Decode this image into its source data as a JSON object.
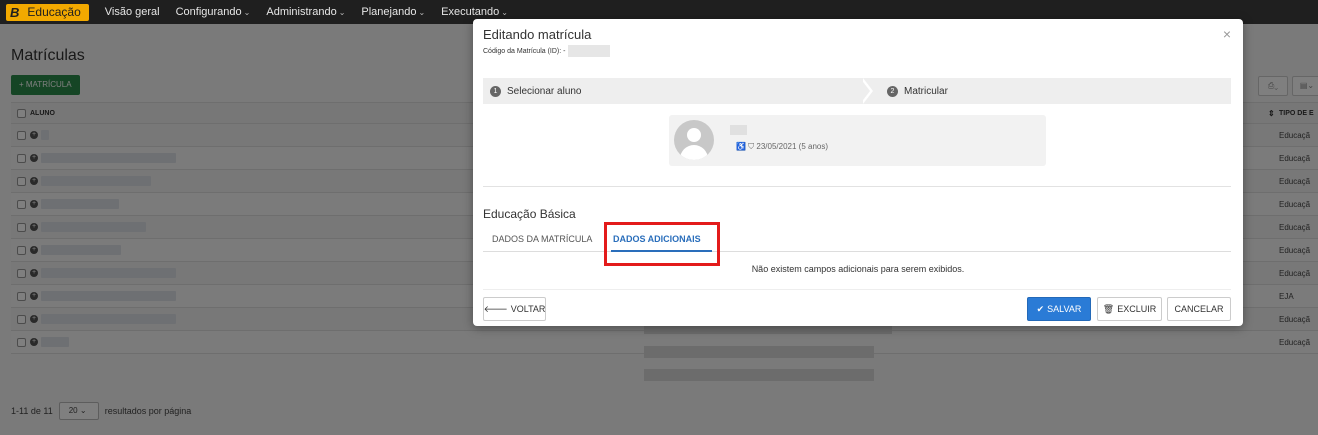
{
  "nav": {
    "brand_letter": "B",
    "brand_label": "Educação",
    "items": [
      {
        "label": "Visão geral",
        "has_caret": false
      },
      {
        "label": "Configurando",
        "has_caret": true
      },
      {
        "label": "Administrando",
        "has_caret": true
      },
      {
        "label": "Planejando",
        "has_caret": true
      },
      {
        "label": "Executando",
        "has_caret": true
      }
    ],
    "caret": "⌄"
  },
  "page": {
    "title": "Matrículas",
    "add_button": "+ MATRÍCULA",
    "table_header": {
      "name": "ALUNO",
      "sort": "⇕",
      "tipo": "TIPO DE E"
    },
    "rows": [
      {
        "tipo": "Educaçã"
      },
      {
        "tipo": "Educaçã"
      },
      {
        "tipo": "Educaçã"
      },
      {
        "tipo": "Educaçã"
      },
      {
        "tipo": "Educaçã"
      },
      {
        "tipo": "Educaçã"
      },
      {
        "tipo": "Educaçã"
      },
      {
        "tipo": "EJA"
      },
      {
        "tipo": "Educaçã"
      },
      {
        "tipo": "Educaçã"
      }
    ],
    "pager": {
      "range": "1-11 de 11",
      "page_size": "20",
      "suffix": "resultados por página"
    },
    "tools": [
      "⎙⌄",
      "▤⌄"
    ]
  },
  "modal": {
    "title": "Editando matrícula",
    "code_label": "Código da Matrícula (ID): -",
    "close": "×",
    "steps": [
      {
        "num": "1",
        "label": "Selecionar aluno"
      },
      {
        "num": "2",
        "label": "Matricular"
      }
    ],
    "student": {
      "info": "♿ ⛉ 23/05/2021 (5 anos)"
    },
    "section_title": "Educação Básica",
    "tabs": [
      {
        "label": "DADOS DA MATRÍCULA",
        "active": false
      },
      {
        "label": "DADOS ADICIONAIS",
        "active": true
      }
    ],
    "empty_message": "Não existem campos adicionais para serem exibidos.",
    "buttons": {
      "back": "VOLTAR",
      "save": "SALVAR",
      "delete": "EXCLUIR",
      "cancel": "CANCELAR"
    },
    "highlight_color": "#e31b1b",
    "accent_color": "#2a7bd6"
  }
}
